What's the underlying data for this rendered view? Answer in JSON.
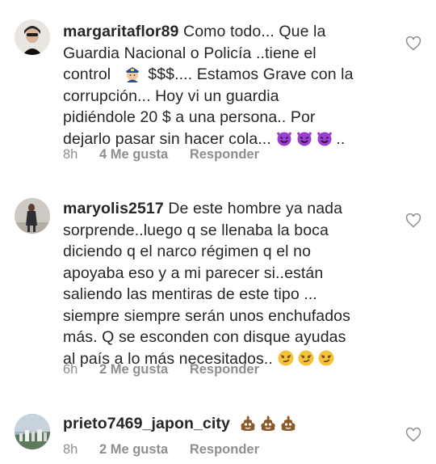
{
  "comments": [
    {
      "username": "margaritaflor89",
      "first_line_text": "Como todo... Que la",
      "lines": [
        "Guardia Nacional o Policía ..tiene el",
        "control",
        "corrupción... Hoy vi un guardia",
        "pidiéndole 20 $ a una persona.. Por",
        "dejarlo pasar sin hacer cola..."
      ],
      "line3_rest": "$$$.... Estamos Grave con la",
      "line6_end": "..",
      "time": "8h",
      "likes": "4 Me gusta",
      "reply": "Responder",
      "emoji": [
        "police-officer-emoji",
        "smiling-imp-emoji"
      ]
    },
    {
      "username": "maryolis2517",
      "first_line_text": "De este hombre ya nada",
      "lines": [
        "sorprende..luego q se llenaba la boca",
        "diciendo q el narco régimen q el no",
        "apoyaba eso y a mi parecer si..están",
        "saliendo las mentiras de este tipo ...",
        "siempre siempre serán unos enchufados",
        "más. Q se esconden con disque ayudas",
        "al país a lo más necesitados.."
      ],
      "time": "6h",
      "likes": "2 Me gusta",
      "reply": "Responder",
      "emoji": [
        "smirking-face-emoji"
      ]
    },
    {
      "username": "prieto7469_japon_city",
      "time": "8h",
      "likes": "2 Me gusta",
      "reply": "Responder",
      "emoji": [
        "pile-of-poo-emoji"
      ]
    }
  ],
  "colors": {
    "text": "#262626",
    "meta": "#8e8e8e",
    "imp_purple": "#9b3fce",
    "smirk_yellow": "#f5c33b",
    "poo_brown": "#8b5a2b"
  }
}
